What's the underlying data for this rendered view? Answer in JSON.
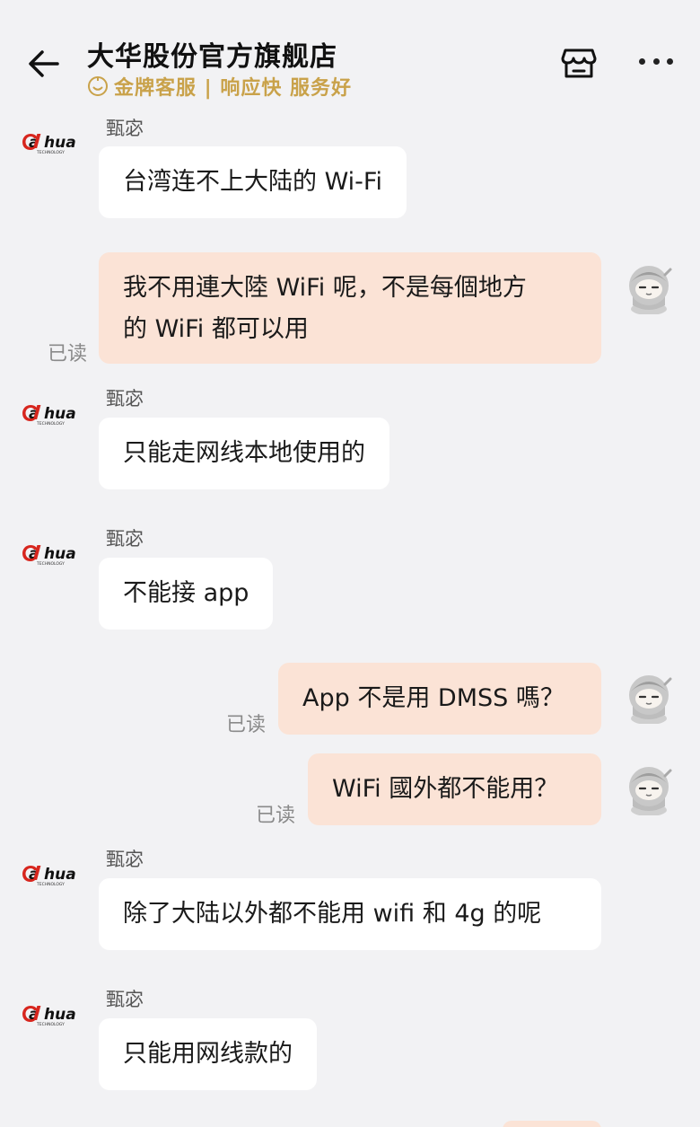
{
  "header": {
    "title": "大华股份官方旗舰店",
    "subtitle": "金牌客服 | 响应快 服务好",
    "back_icon": "arrow-left-icon",
    "shop_icon": "store-icon",
    "more_icon": "more-dots-icon"
  },
  "colors": {
    "background": "#f2f2f4",
    "incoming_bubble": "#ffffff",
    "outgoing_bubble": "#fbe3d6",
    "gold": "#c9a24a",
    "brand_red": "#d7261e"
  },
  "brand_logo": {
    "text": "alhua",
    "subtext": "TECHNOLOGY"
  },
  "read_label": "已读",
  "messages": [
    {
      "from": "agent",
      "sender": "甄宓",
      "text": "台湾连不上大陆的 Wi-Fi"
    },
    {
      "from": "me",
      "lines": [
        "我不用連大陸 WiFi 呢，不是每個地方",
        "的 WiFi 都可以用"
      ],
      "status": "已读"
    },
    {
      "from": "agent",
      "sender": "甄宓",
      "text": "只能走网线本地使用的"
    },
    {
      "from": "agent",
      "sender": "甄宓",
      "text": "不能接 app"
    },
    {
      "from": "me",
      "text": "App 不是用 DMSS 嗎？",
      "status": "已读"
    },
    {
      "from": "me",
      "text": "WiFi 國外都不能用？",
      "status": "已读"
    },
    {
      "from": "agent",
      "sender": "甄宓",
      "text": "除了大陆以外都不能用 wifi 和 4g 的呢"
    },
    {
      "from": "agent",
      "sender": "甄宓",
      "text": "只能用网线款的"
    }
  ]
}
